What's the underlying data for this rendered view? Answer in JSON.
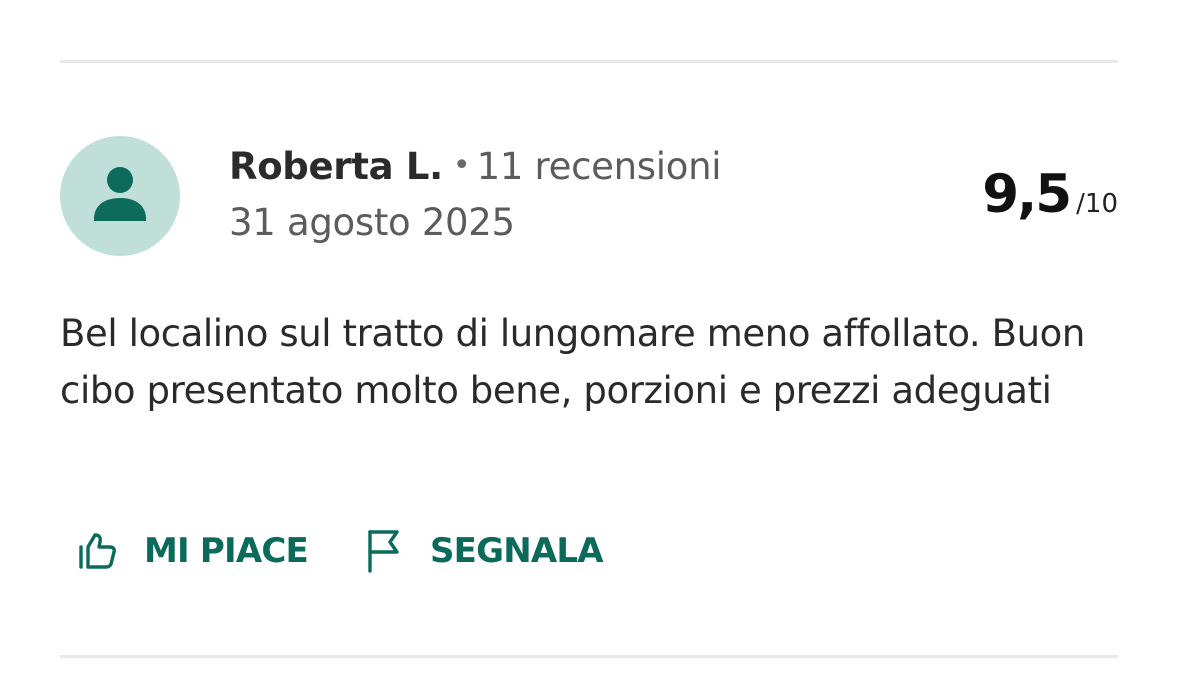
{
  "review": {
    "reviewer": {
      "name": "Roberta L.",
      "separator": "•",
      "review_count": "11 recensioni",
      "avatar_icon": "user-icon"
    },
    "date": "31 agosto 2025",
    "score": {
      "value": "9,5",
      "max": "/10"
    },
    "text": "Bel localino sul tratto di lungomare meno affollato. Buon cibo presentato molto bene, porzioni e prezzi adeguati",
    "actions": {
      "like": {
        "label": "MI PIACE",
        "icon": "thumbs-up-icon"
      },
      "report": {
        "label": "SEGNALA",
        "icon": "flag-icon"
      }
    }
  },
  "colors": {
    "accent": "#0b6b5a",
    "avatar_bg": "#c0dfd9",
    "avatar_fg": "#0d6b5b",
    "secondary_text": "#5c5c60",
    "divider": "#e8e8e8"
  }
}
